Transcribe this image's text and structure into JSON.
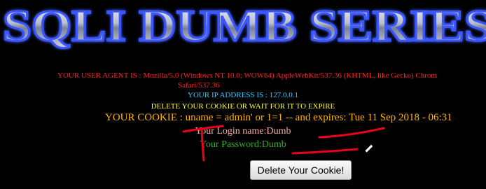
{
  "banner": {
    "title": "SQLI DUMB SERIES"
  },
  "info": {
    "user_agent_label": "YOUR USER AGENT IS : ",
    "user_agent_value": "Mozilla/5.0 (Windows NT 10.0; WOW64) AppleWebKit/537.36 (KHTML, like Gecko) Chrom",
    "user_agent_wrap": "Safari/537.36",
    "ip_text": "YOUR IP ADDRESS IS : 127.0.0.1",
    "delete_notice": "DELETE YOUR COOKIE OR WAIT FOR IT TO EXPIRE",
    "cookie_text": "YOUR COOKIE : uname = admin' or 1=1 -- and expires: Tue 11 Sep 2018 - 06:31",
    "login_label": "Your Login name:",
    "login_value": "Dumb",
    "password_label": "Your Password:",
    "password_value": "Dumb"
  },
  "button": {
    "delete_label": "Delete Your Cookie!"
  },
  "colors": {
    "background": "#000000",
    "user_agent": "#ff2020",
    "ip": "#33ccff",
    "notice": "#ffff33",
    "cookie": "#ffb300",
    "login": "#ffaaaa",
    "password": "#33aa33",
    "annotation": "#e8001c"
  }
}
